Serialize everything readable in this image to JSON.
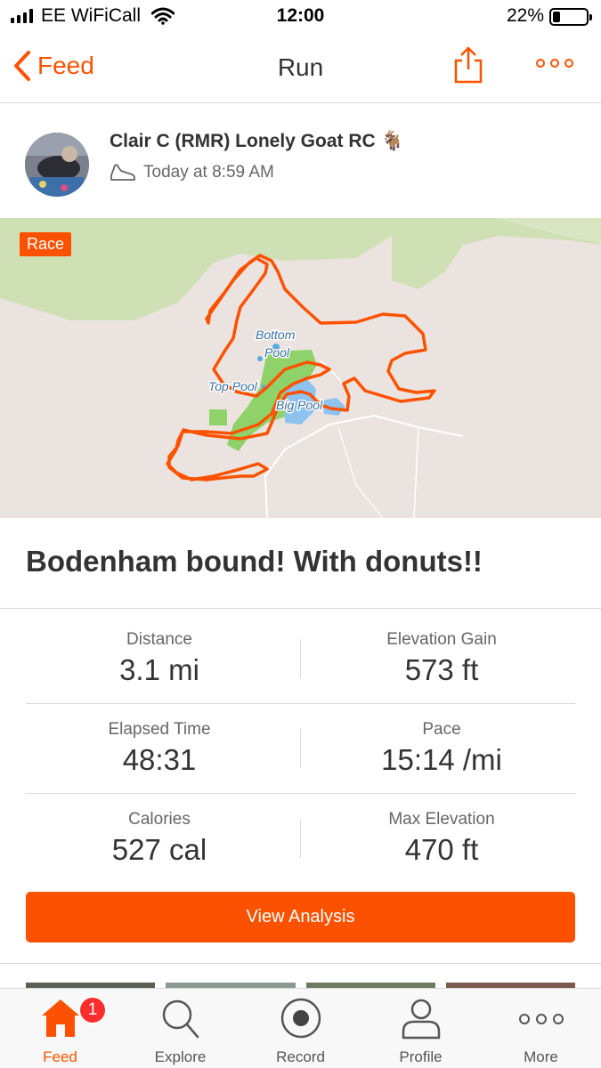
{
  "status_bar": {
    "carrier": "EE WiFiCall",
    "time": "12:00",
    "battery": "22%",
    "battery_level": 0.22
  },
  "nav": {
    "back_label": "Feed",
    "title": "Run"
  },
  "athlete": {
    "name": "Clair C (RMR) Lonely Goat RC 🐐",
    "timestamp": "Today at 8:59 AM"
  },
  "map": {
    "badge": "Race",
    "labels": [
      "Bottom",
      "Pool",
      "Top Pool",
      "Big Pool"
    ]
  },
  "activity": {
    "title": "Bodenham bound! With donuts!!"
  },
  "stats": [
    {
      "left": {
        "label": "Distance",
        "value": "3.1 mi"
      },
      "right": {
        "label": "Elevation Gain",
        "value": "573 ft"
      }
    },
    {
      "left": {
        "label": "Elapsed Time",
        "value": "48:31"
      },
      "right": {
        "label": "Pace",
        "value": "15:14 /mi"
      }
    },
    {
      "left": {
        "label": "Calories",
        "value": "527 cal"
      },
      "right": {
        "label": "Max Elevation",
        "value": "470 ft"
      }
    }
  ],
  "analysis_button": "View Analysis",
  "tabs": [
    {
      "label": "Feed",
      "icon": "home-icon",
      "badge": "1"
    },
    {
      "label": "Explore",
      "icon": "search-icon"
    },
    {
      "label": "Record",
      "icon": "record-icon"
    },
    {
      "label": "Profile",
      "icon": "profile-icon"
    },
    {
      "label": "More",
      "icon": "more-dots-icon"
    }
  ],
  "colors": {
    "accent": "#fc5200",
    "map_background": "#ebe3df",
    "map_green": "#cfe0b4",
    "map_park": "#8fd26a",
    "water": "#8ec3ef"
  }
}
